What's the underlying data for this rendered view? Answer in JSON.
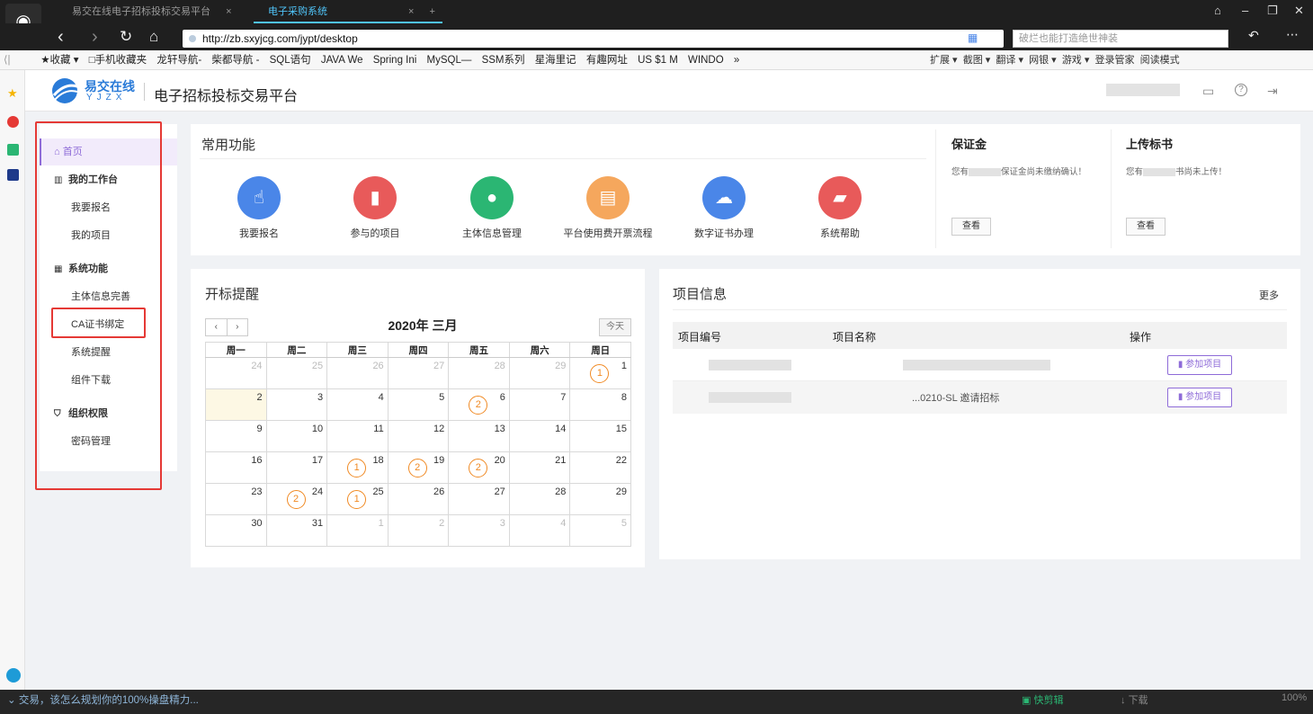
{
  "browser": {
    "tabs": [
      {
        "label": "易交在线电子招标投标交易平台",
        "close": "×"
      },
      {
        "label": "电子采购系统",
        "close": "×"
      }
    ],
    "new_tab": "+",
    "url": "http://zb.sxyjcg.com/jypt/desktop",
    "search_placeholder": "破烂也能打造绝世神装",
    "bookmarks": [
      "★收藏 ▾",
      "□手机收藏夹",
      "龙轩导航-",
      "柴都导航 -",
      "SQL语句",
      "JAVA We",
      "Spring Ini",
      "MySQL—",
      "SSM系列",
      "星海里记",
      "有趣网址",
      "US $1 M",
      "WINDO",
      "»"
    ],
    "bookmarks_right": [
      "扩展 ▾",
      "截图 ▾",
      "翻译 ▾",
      "网银 ▾",
      "游戏 ▾",
      "登录管家",
      "阅读模式"
    ],
    "status_left": "交易，该怎么规划你的100%操盘精力...",
    "status_right": "快剪辑",
    "status_right2": "下载",
    "zoom": "100%"
  },
  "header": {
    "brand_cn": "易交在线",
    "brand_en": "YJZX",
    "title": "电子招标投标交易平台"
  },
  "sidebar": {
    "home": "首页",
    "groups": [
      {
        "label": "我的工作台",
        "items": [
          "我要报名",
          "我的项目"
        ]
      },
      {
        "label": "系统功能",
        "items": [
          "主体信息完善",
          "CA证书绑定",
          "系统提醒",
          "组件下载"
        ]
      },
      {
        "label": "组织权限",
        "items": [
          "密码管理"
        ]
      }
    ]
  },
  "common": {
    "title": "常用功能",
    "functions": [
      {
        "label": "我要报名",
        "icon": "hand-icon",
        "color": "#4a86e8"
      },
      {
        "label": "参与的项目",
        "icon": "file-icon",
        "color": "#e85a5a"
      },
      {
        "label": "主体信息管理",
        "icon": "user-icon",
        "color": "#2bb673"
      },
      {
        "label": "平台使用费开票流程",
        "icon": "document-icon",
        "color": "#f5a75d"
      },
      {
        "label": "数字证书办理",
        "icon": "cloud-download-icon",
        "color": "#4a86e8"
      },
      {
        "label": "系统帮助",
        "icon": "book-icon",
        "color": "#e85a5a"
      }
    ]
  },
  "deposit": {
    "title": "保证金",
    "msg_a": "您有",
    "msg_b": "保证金尚未缴纳确认！",
    "button": "查看"
  },
  "upload": {
    "title": "上传标书",
    "msg_a": "您有",
    "msg_b": "书尚未上传！",
    "button": "查看"
  },
  "calendar": {
    "title": "开标提醒",
    "month_label": "2020年 三月",
    "today_button": "今天",
    "prev": "‹",
    "next": "›",
    "weekdays": [
      "周一",
      "周二",
      "周三",
      "周四",
      "周五",
      "周六",
      "周日"
    ],
    "weeks": [
      [
        {
          "d": "24",
          "o": true
        },
        {
          "d": "25",
          "o": true
        },
        {
          "d": "26",
          "o": true
        },
        {
          "d": "27",
          "o": true
        },
        {
          "d": "28",
          "o": true
        },
        {
          "d": "29",
          "o": true
        },
        {
          "d": "1",
          "b": "1"
        }
      ],
      [
        {
          "d": "2",
          "t": true
        },
        {
          "d": "3"
        },
        {
          "d": "4"
        },
        {
          "d": "5"
        },
        {
          "d": "6",
          "b": "2"
        },
        {
          "d": "7"
        },
        {
          "d": "8"
        }
      ],
      [
        {
          "d": "9"
        },
        {
          "d": "10"
        },
        {
          "d": "11"
        },
        {
          "d": "12"
        },
        {
          "d": "13"
        },
        {
          "d": "14"
        },
        {
          "d": "15"
        }
      ],
      [
        {
          "d": "16"
        },
        {
          "d": "17"
        },
        {
          "d": "18",
          "b": "1"
        },
        {
          "d": "19",
          "b": "2"
        },
        {
          "d": "20",
          "b": "2"
        },
        {
          "d": "21"
        },
        {
          "d": "22"
        }
      ],
      [
        {
          "d": "23"
        },
        {
          "d": "24",
          "b": "2"
        },
        {
          "d": "25",
          "b": "1"
        },
        {
          "d": "26"
        },
        {
          "d": "27"
        },
        {
          "d": "28"
        },
        {
          "d": "29"
        }
      ],
      [
        {
          "d": "30"
        },
        {
          "d": "31"
        },
        {
          "d": "1",
          "o": true
        },
        {
          "d": "2",
          "o": true
        },
        {
          "d": "3",
          "o": true
        },
        {
          "d": "4",
          "o": true
        },
        {
          "d": "5",
          "o": true
        }
      ]
    ]
  },
  "projects": {
    "title": "项目信息",
    "more": "更多",
    "columns": [
      "项目编号",
      "项目名称",
      "操作"
    ],
    "rows": [
      {
        "action": "参加项目"
      },
      {
        "name_partial": "...0210-SL 邀请招标",
        "action": "参加项目"
      }
    ]
  }
}
